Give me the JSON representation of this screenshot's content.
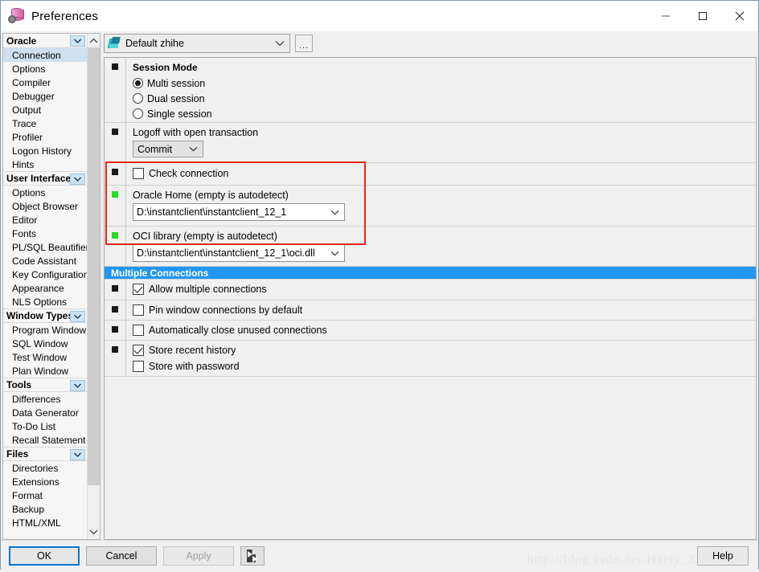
{
  "window": {
    "title": "Preferences",
    "icon": "database-gear-icon",
    "controls": {
      "minimize": "minimize-icon",
      "maximize": "maximize-icon",
      "close": "close-icon"
    }
  },
  "sidebar": {
    "groups": [
      {
        "label": "Oracle",
        "items": [
          {
            "label": "Connection",
            "selected": true
          },
          {
            "label": "Options",
            "selected": false
          },
          {
            "label": "Compiler",
            "selected": false
          },
          {
            "label": "Debugger",
            "selected": false
          },
          {
            "label": "Output",
            "selected": false
          },
          {
            "label": "Trace",
            "selected": false
          },
          {
            "label": "Profiler",
            "selected": false
          },
          {
            "label": "Logon History",
            "selected": false
          },
          {
            "label": "Hints",
            "selected": false
          }
        ]
      },
      {
        "label": "User Interface",
        "items": [
          {
            "label": "Options",
            "selected": false
          },
          {
            "label": "Object Browser",
            "selected": false
          },
          {
            "label": "Editor",
            "selected": false
          },
          {
            "label": "Fonts",
            "selected": false
          },
          {
            "label": "PL/SQL Beautifier",
            "selected": false
          },
          {
            "label": "Code Assistant",
            "selected": false
          },
          {
            "label": "Key Configuration",
            "selected": false
          },
          {
            "label": "Appearance",
            "selected": false
          },
          {
            "label": "NLS Options",
            "selected": false
          }
        ]
      },
      {
        "label": "Window Types",
        "items": [
          {
            "label": "Program Window",
            "selected": false
          },
          {
            "label": "SQL Window",
            "selected": false
          },
          {
            "label": "Test Window",
            "selected": false
          },
          {
            "label": "Plan Window",
            "selected": false
          }
        ]
      },
      {
        "label": "Tools",
        "items": [
          {
            "label": "Differences",
            "selected": false
          },
          {
            "label": "Data Generator",
            "selected": false
          },
          {
            "label": "To-Do List",
            "selected": false
          },
          {
            "label": "Recall Statement",
            "selected": false
          }
        ]
      },
      {
        "label": "Files",
        "items": [
          {
            "label": "Directories",
            "selected": false
          },
          {
            "label": "Extensions",
            "selected": false
          },
          {
            "label": "Format",
            "selected": false
          },
          {
            "label": "Backup",
            "selected": false
          },
          {
            "label": "HTML/XML",
            "selected": false
          }
        ]
      }
    ]
  },
  "profile": {
    "icon": "preference-set-icon",
    "value": "Default zhihe",
    "more_button": "..."
  },
  "main": {
    "session_mode": {
      "title": "Session Mode",
      "options": [
        {
          "label": "Multi session",
          "checked": true
        },
        {
          "label": "Dual session",
          "checked": false
        },
        {
          "label": "Single session",
          "checked": false
        }
      ]
    },
    "logoff": {
      "label": "Logoff with open transaction",
      "value": "Commit"
    },
    "check_connection": {
      "label": "Check connection",
      "checked": false
    },
    "oracle_home": {
      "label": "Oracle Home (empty is autodetect)",
      "value": "D:\\instantclient\\instantclient_12_1"
    },
    "oci_library": {
      "label": "OCI library (empty is autodetect)",
      "value": "D:\\instantclient\\instantclient_12_1\\oci.dll"
    },
    "multiple_connections": {
      "header": "Multiple Connections",
      "items": [
        {
          "label": "Allow multiple connections",
          "checked": true
        },
        {
          "label": "Pin window connections by default",
          "checked": false
        },
        {
          "label": "Automatically close unused connections",
          "checked": false
        },
        {
          "label": "Store recent history",
          "checked": true
        },
        {
          "label": "Store with password",
          "checked": false
        }
      ]
    }
  },
  "footer": {
    "ok": "OK",
    "cancel": "Cancel",
    "apply": "Apply",
    "import_export_icon": "import-export-icon",
    "help": "Help",
    "watermark": "http://blog.csdn.net/Harry_ZhiZhang"
  },
  "colors": {
    "accent_blue": "#2196f3",
    "highlight_red": "#e8261b",
    "selection": "#cfe0f0",
    "green_marker": "#22dd22"
  }
}
